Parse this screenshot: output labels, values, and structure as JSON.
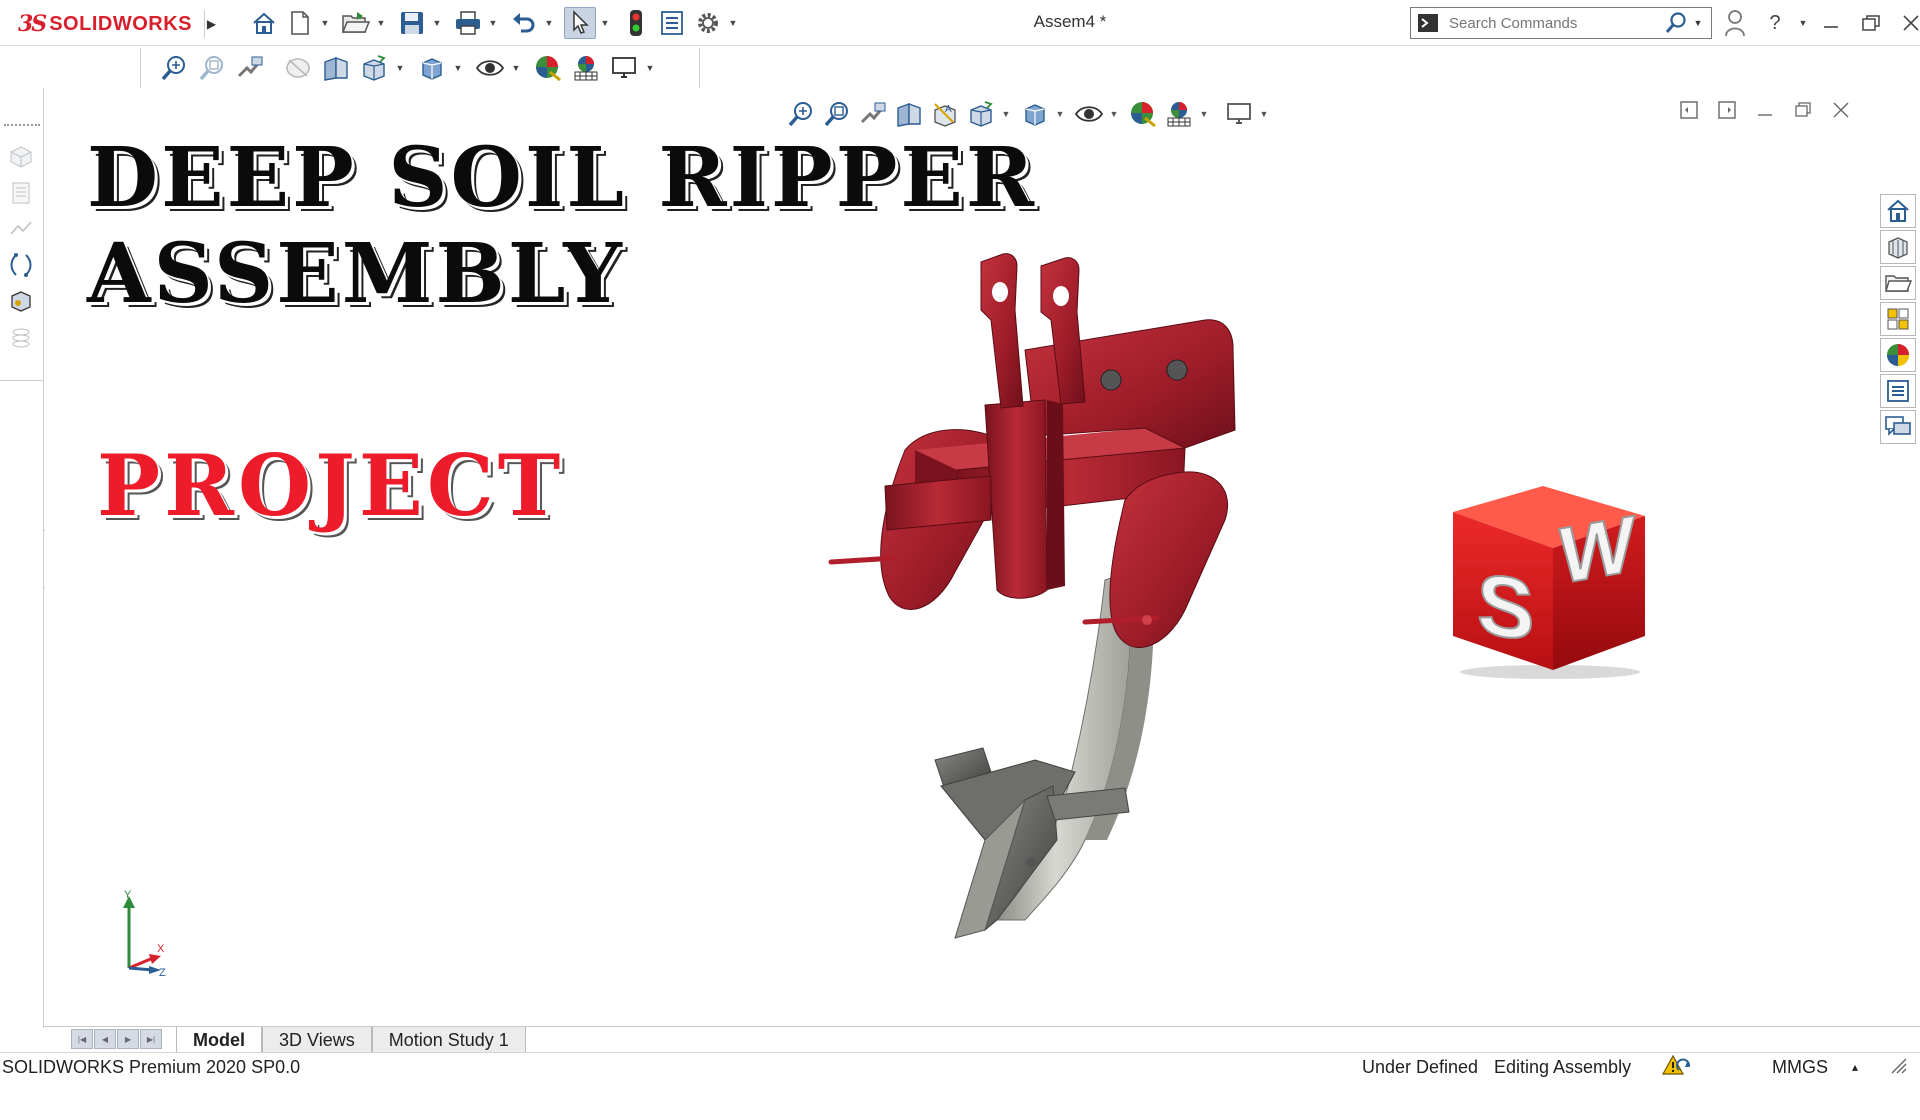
{
  "titlebar": {
    "brand_ds": "3S",
    "brand_name": "SOLIDWORKS",
    "document_title": "Assem4 *",
    "search_placeholder": "Search Commands",
    "window_controls": [
      "user-icon",
      "help-icon",
      "minimize-icon",
      "restore-icon",
      "close-icon"
    ]
  },
  "quick_access": [
    "home-icon",
    "new-document-icon",
    "open-icon",
    "save-icon",
    "print-icon",
    "undo-icon",
    "select-icon",
    "rebuild-icon",
    "file-properties-icon",
    "options-icon"
  ],
  "headsup_toolbar": [
    "zoom-to-fit-icon",
    "zoom-to-area-icon",
    "previous-view-icon",
    "section-view-icon",
    "dynamic-annotation-icon",
    "view-orientation-icon",
    "display-style-icon",
    "hide-show-icon",
    "edit-appearance-icon",
    "apply-scene-icon",
    "view-settings-icon"
  ],
  "viewport": {
    "title_line1": "DEEP SOIL RIPPER",
    "title_line2": "ASSEMBLY",
    "subtitle": "PROJECT",
    "logo_letters": "SW",
    "triad": {
      "x": "X",
      "y": "Y",
      "z": "Z"
    }
  },
  "taskpane": [
    "solidworks-resources-icon",
    "design-library-icon",
    "file-explorer-icon",
    "view-palette-icon",
    "appearances-icon",
    "custom-properties-icon",
    "forum-icon"
  ],
  "tabs": {
    "model": "Model",
    "views3d": "3D Views",
    "motion": "Motion Study 1"
  },
  "status": {
    "product": "SOLIDWORKS Premium 2020 SP0.0",
    "definition": "Under Defined",
    "mode": "Editing Assembly",
    "units": "MMGS",
    "units_arrow": "▴"
  },
  "colors": {
    "brand_red": "#d8202c",
    "part_red": "#a4202e",
    "title_red": "#ee1c2a",
    "steel": "#b9b9b3"
  }
}
